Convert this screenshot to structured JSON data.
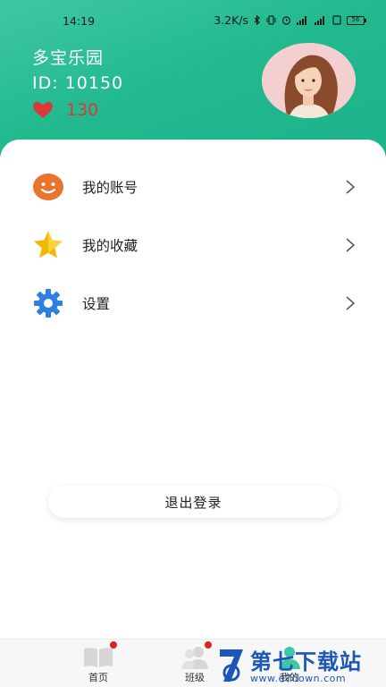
{
  "status_bar": {
    "time": "14:19",
    "speed": "3.2K/s",
    "battery": "56"
  },
  "profile": {
    "app_name": "多宝乐园",
    "user_id": "ID:  10150",
    "likes": "130"
  },
  "menu": {
    "items": [
      {
        "label": "我的账号",
        "icon": "smiley-icon"
      },
      {
        "label": "我的收藏",
        "icon": "star-icon"
      },
      {
        "label": "设置",
        "icon": "gear-icon"
      }
    ]
  },
  "logout_label": "退出登录",
  "tabbar": {
    "tabs": [
      {
        "label": "首页",
        "icon": "book-icon"
      },
      {
        "label": "班级",
        "icon": "users-icon"
      },
      {
        "label": "我的",
        "icon": "profile-icon"
      }
    ]
  },
  "watermark": {
    "title": "第七下载站",
    "url": "www.d7down.com"
  },
  "colors": {
    "header": "#22b98f",
    "heart": "#d83a3a",
    "smiley": "#e8742e",
    "star": "#f5b800",
    "gear": "#2d7fe0",
    "badge": "#e02020",
    "watermark": "#1c57b8"
  }
}
